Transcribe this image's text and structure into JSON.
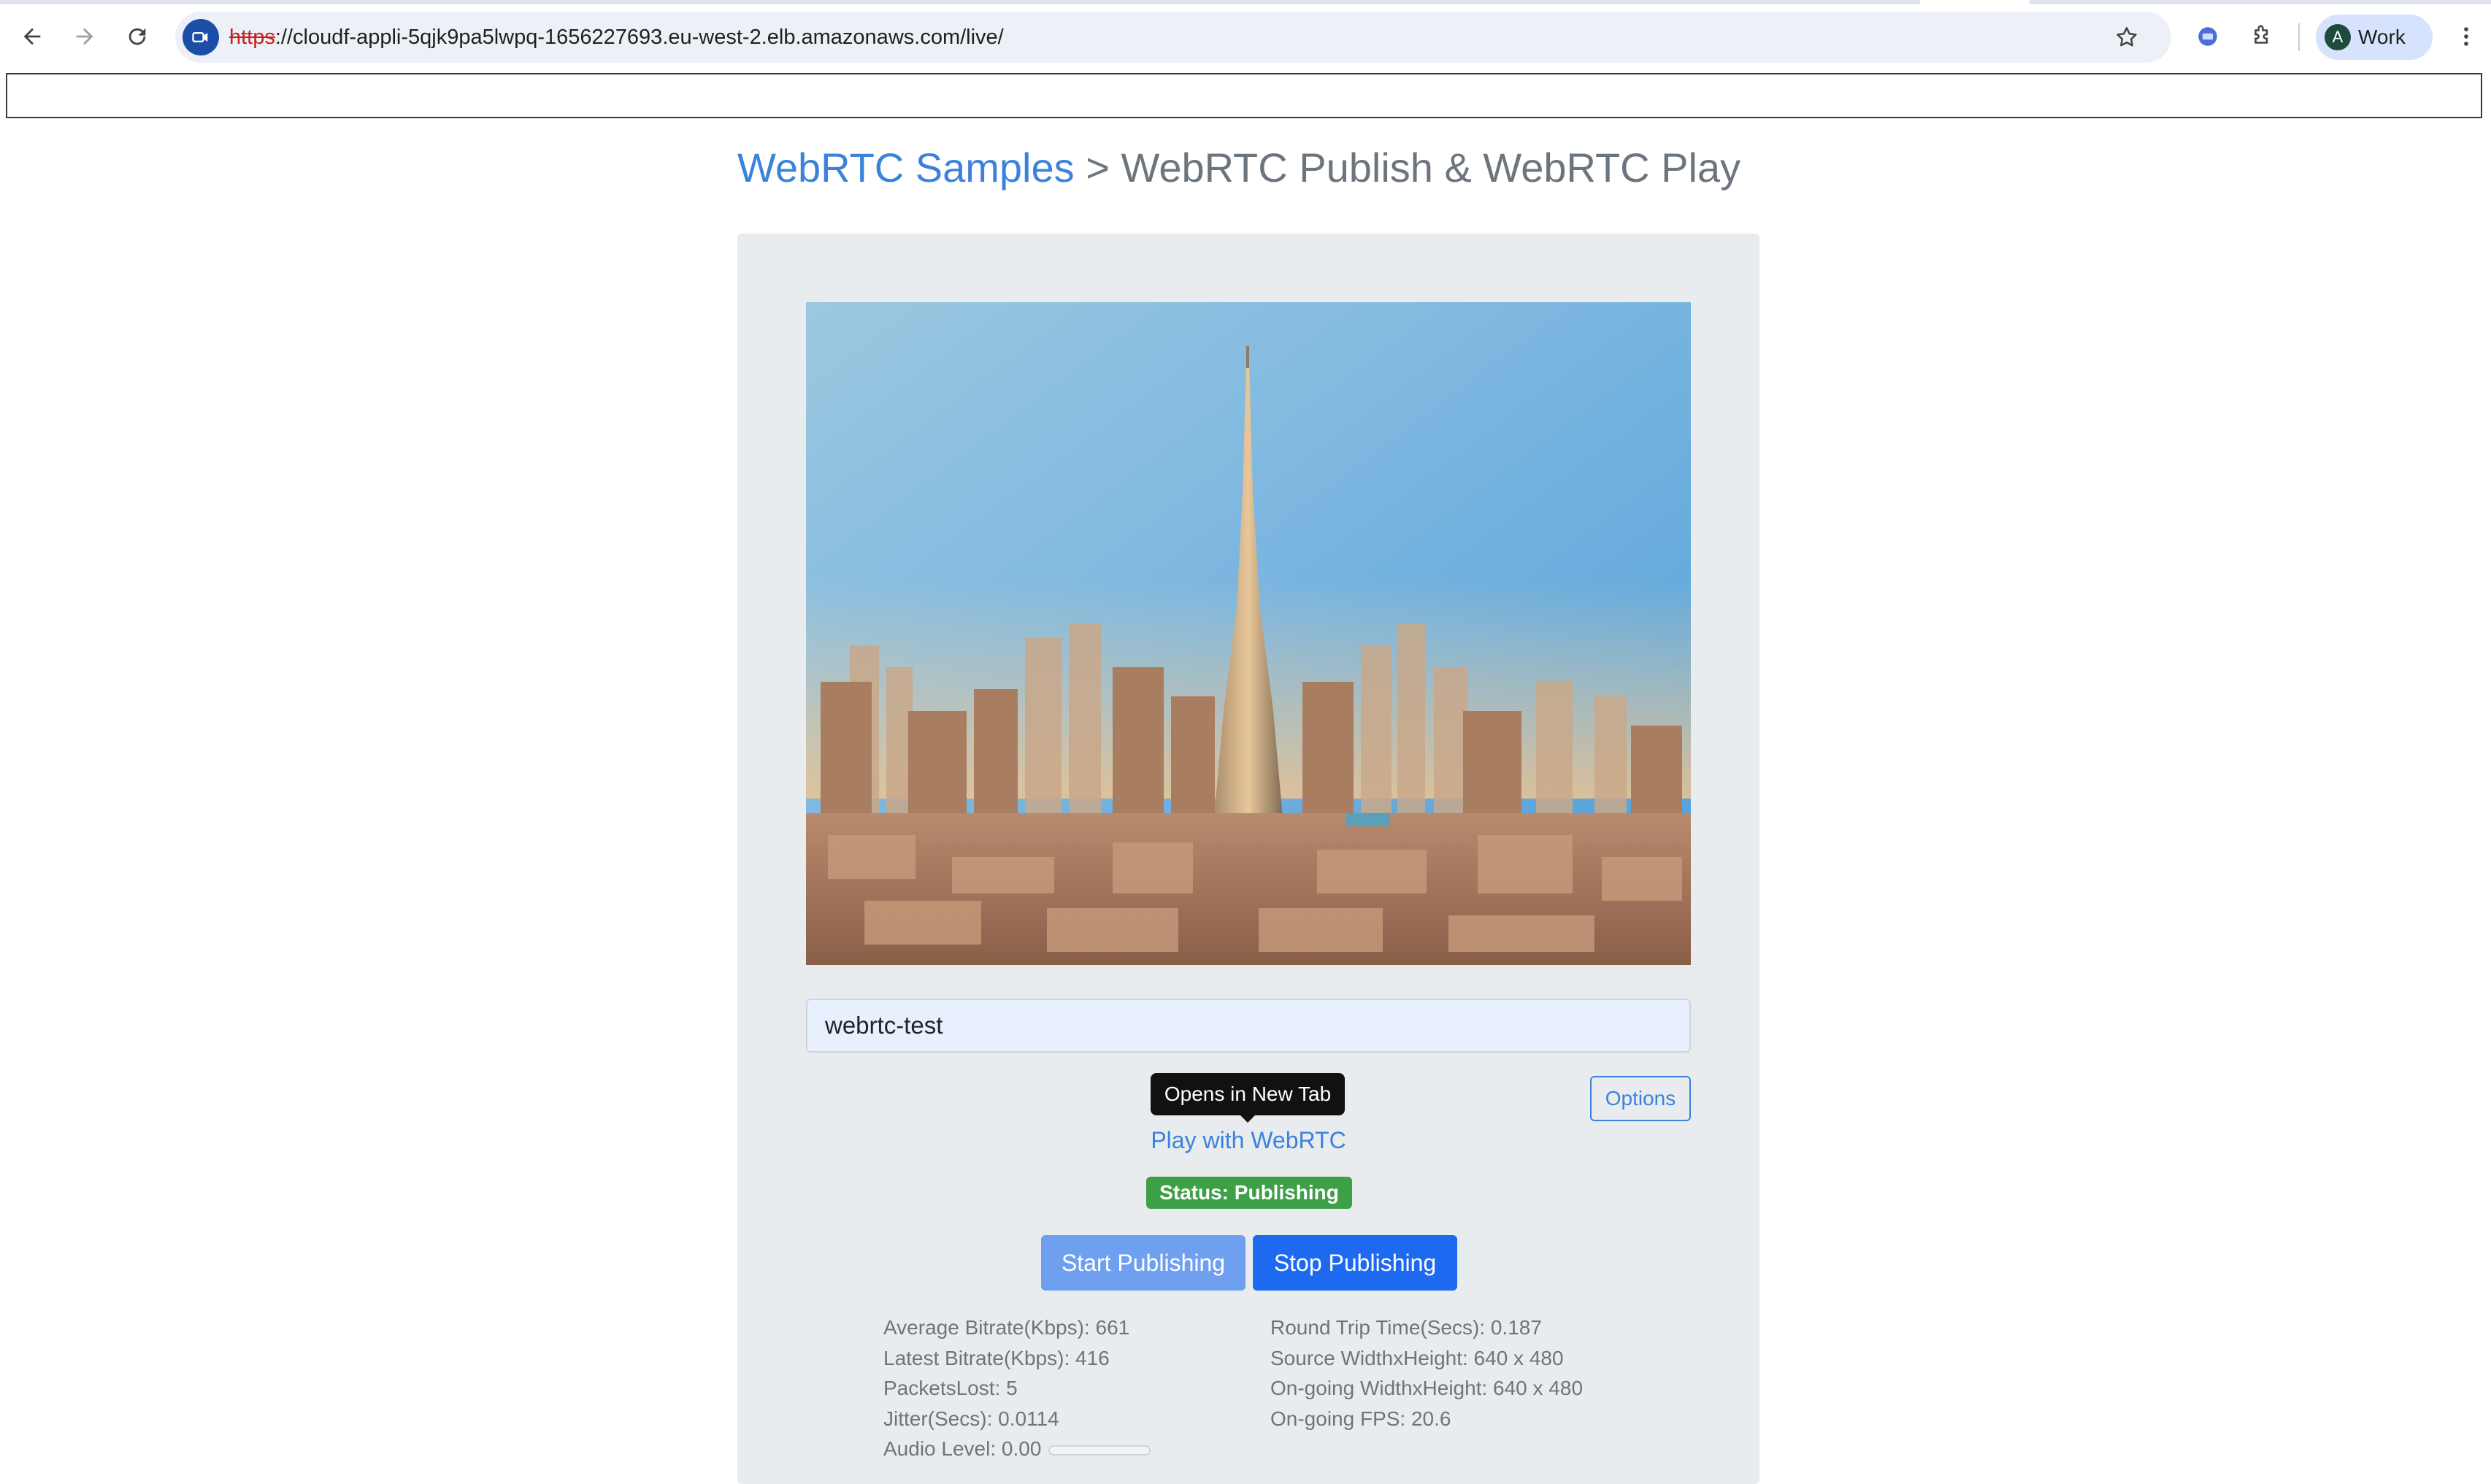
{
  "browser": {
    "url_scheme": "https",
    "url_rest": "://cloudf-appli-5qjk9pa5lwpq-1656227693.eu-west-2.elb.amazonaws.com/live/",
    "profile_initial": "A",
    "profile_name": "Work"
  },
  "page": {
    "breadcrumb_link": "WebRTC Samples",
    "breadcrumb_current": " > WebRTC Publish & WebRTC Play",
    "stream_id": "webrtc-test",
    "tooltip": "Opens in New Tab",
    "play_link": "Play with WebRTC",
    "options_label": "Options",
    "status": "Status: Publishing",
    "start_label": "Start Publishing",
    "stop_label": "Stop Publishing"
  },
  "stats": {
    "left": [
      "Average Bitrate(Kbps): 661",
      "Latest Bitrate(Kbps): 416",
      "PacketsLost: 5",
      "Jitter(Secs): 0.0114",
      "Audio Level: 0.00"
    ],
    "right": [
      "Round Trip Time(Secs): 0.187",
      "Source WidthxHeight: 640 x 480",
      "On-going WidthxHeight: 640 x 480",
      "On-going FPS: 20.6"
    ],
    "audio_level": 0.0
  },
  "colors": {
    "accent": "#3b82dc",
    "primary_button": "#1d6af0",
    "disabled_button": "#6fa0f0",
    "status_green": "#3ea046"
  }
}
